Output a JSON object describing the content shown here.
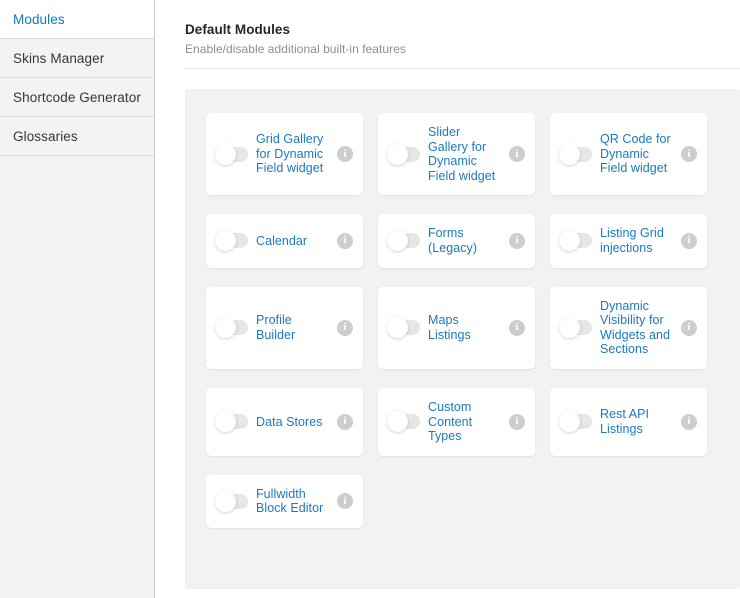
{
  "sidebar": {
    "items": [
      {
        "label": "Modules",
        "active": true
      },
      {
        "label": "Skins Manager",
        "active": false
      },
      {
        "label": "Shortcode Generator",
        "active": false
      },
      {
        "label": "Glossaries",
        "active": false
      }
    ]
  },
  "header": {
    "title": "Default Modules",
    "subtitle": "Enable/disable additional built-in features"
  },
  "modules": {
    "toggle_state": "off",
    "info_glyph": "i",
    "rows": [
      [
        {
          "label": "Grid Gallery for Dynamic Field widget",
          "enabled": false
        },
        {
          "label": "Slider Gallery for Dynamic Field widget",
          "enabled": false
        },
        {
          "label": "QR Code for Dynamic Field widget",
          "enabled": false
        }
      ],
      [
        {
          "label": "Calendar",
          "enabled": false
        },
        {
          "label": "Forms (Legacy)",
          "enabled": false
        },
        {
          "label": "Listing Grid injections",
          "enabled": false
        }
      ],
      [
        {
          "label": "Profile Builder",
          "enabled": false
        },
        {
          "label": "Maps Listings",
          "enabled": false
        },
        {
          "label": "Dynamic Visibility for Widgets and Sections",
          "enabled": false
        }
      ],
      [
        {
          "label": "Data Stores",
          "enabled": false
        },
        {
          "label": "Custom Content Types",
          "enabled": false
        },
        {
          "label": "Rest API Listings",
          "enabled": false
        }
      ],
      [
        {
          "label": "Fullwidth Block Editor",
          "enabled": false
        }
      ]
    ]
  },
  "colors": {
    "link": "#1b7ac0",
    "panel_bg": "#f2f2f2",
    "sidebar_bg": "#f3f3f3",
    "card_bg": "#ffffff",
    "info_icon": "#cdcdcd"
  }
}
